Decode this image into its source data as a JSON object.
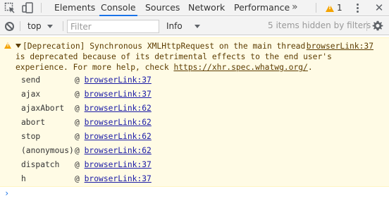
{
  "tabbar": {
    "tabs": [
      {
        "label": "Elements",
        "active": false
      },
      {
        "label": "Console",
        "active": true
      },
      {
        "label": "Sources",
        "active": false
      },
      {
        "label": "Network",
        "active": false
      },
      {
        "label": "Performance",
        "active": false
      }
    ],
    "more_tabs_label": "»",
    "warning_count": "1",
    "icons": [
      "inspect-element-icon",
      "device-toolbar-icon",
      "more-tabs-icon",
      "warning-icon",
      "kebab-menu-icon",
      "close-icon"
    ]
  },
  "toolbar": {
    "context": "top",
    "filter_placeholder": "Filter",
    "filter_value": "",
    "level": "Info",
    "hidden_items": "5 items hidden by filters",
    "icons": [
      "clear-console-icon",
      "chevron-down-icon",
      "gear-icon"
    ]
  },
  "warning_message": {
    "line1": "[Deprecation] Synchronous XMLHttpRequest on the main thread",
    "line2": "is deprecated because of its detrimental effects to the end user's",
    "line3_prefix": "experience. For more help, check ",
    "line3_link": "https://xhr.spec.whatwg.org/",
    "line3_suffix": ".",
    "source": "browserLink:37",
    "stack": [
      {
        "fn": "send",
        "at": "@",
        "loc": "browserLink:37"
      },
      {
        "fn": "ajax",
        "at": "@",
        "loc": "browserLink:37"
      },
      {
        "fn": "ajaxAbort",
        "at": "@",
        "loc": "browserLink:62"
      },
      {
        "fn": "abort",
        "at": "@",
        "loc": "browserLink:62"
      },
      {
        "fn": "stop",
        "at": "@",
        "loc": "browserLink:62"
      },
      {
        "fn": "(anonymous)",
        "at": "@",
        "loc": "browserLink:62"
      },
      {
        "fn": "dispatch",
        "at": "@",
        "loc": "browserLink:37"
      },
      {
        "fn": "h",
        "at": "@",
        "loc": "browserLink:37"
      }
    ]
  },
  "prompt_symbol": "›",
  "colors": {
    "accent": "#1a73e8",
    "warning_bg": "#fffbe5",
    "warning_text": "#5c3c00",
    "warning_icon": "#f4a400"
  }
}
